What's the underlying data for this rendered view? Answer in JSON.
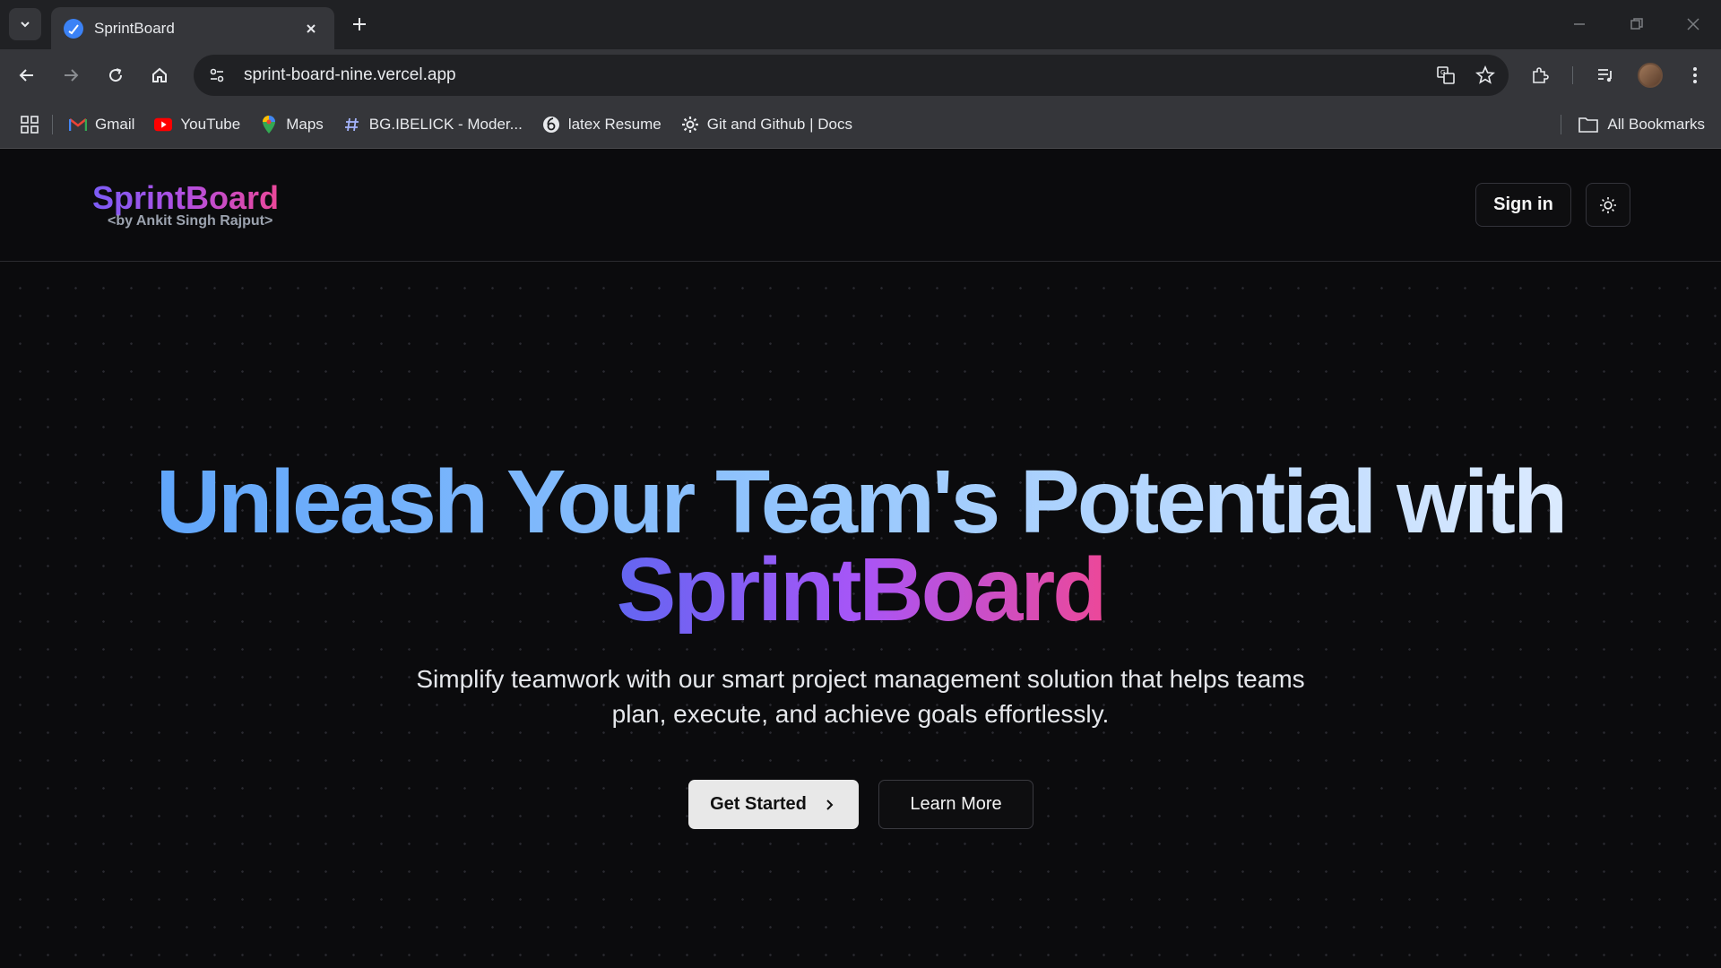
{
  "browser": {
    "tab_title": "SprintBoard",
    "url": "sprint-board-nine.vercel.app",
    "bookmarks": [
      {
        "label": "Gmail",
        "icon": "gmail-icon"
      },
      {
        "label": "YouTube",
        "icon": "youtube-icon"
      },
      {
        "label": "Maps",
        "icon": "maps-icon"
      },
      {
        "label": "BG.IBELICK - Moder...",
        "icon": "hash-icon"
      },
      {
        "label": "latex Resume",
        "icon": "overleaf-icon"
      },
      {
        "label": "Git and Github | Docs",
        "icon": "gear-icon"
      }
    ],
    "all_bookmarks": "All Bookmarks"
  },
  "header": {
    "logo_title": "SprintBoard",
    "logo_subtitle": "<by Ankit Singh Rajput>",
    "signin_label": "Sign in"
  },
  "hero": {
    "title_line1": "Unleash Your Team's Potential with",
    "title_line2": "SprintBoard",
    "subtitle_line1": "Simplify teamwork with our smart project management solution that helps teams",
    "subtitle_line2": "plan, execute, and achieve goals effortlessly.",
    "primary_cta": "Get Started",
    "secondary_cta": "Learn More"
  },
  "colors": {
    "brand_gradient_start": "#7c5cf6",
    "brand_gradient_end": "#ec4899",
    "hero_blue": "#60a5fa",
    "background": "#0b0b0d"
  }
}
